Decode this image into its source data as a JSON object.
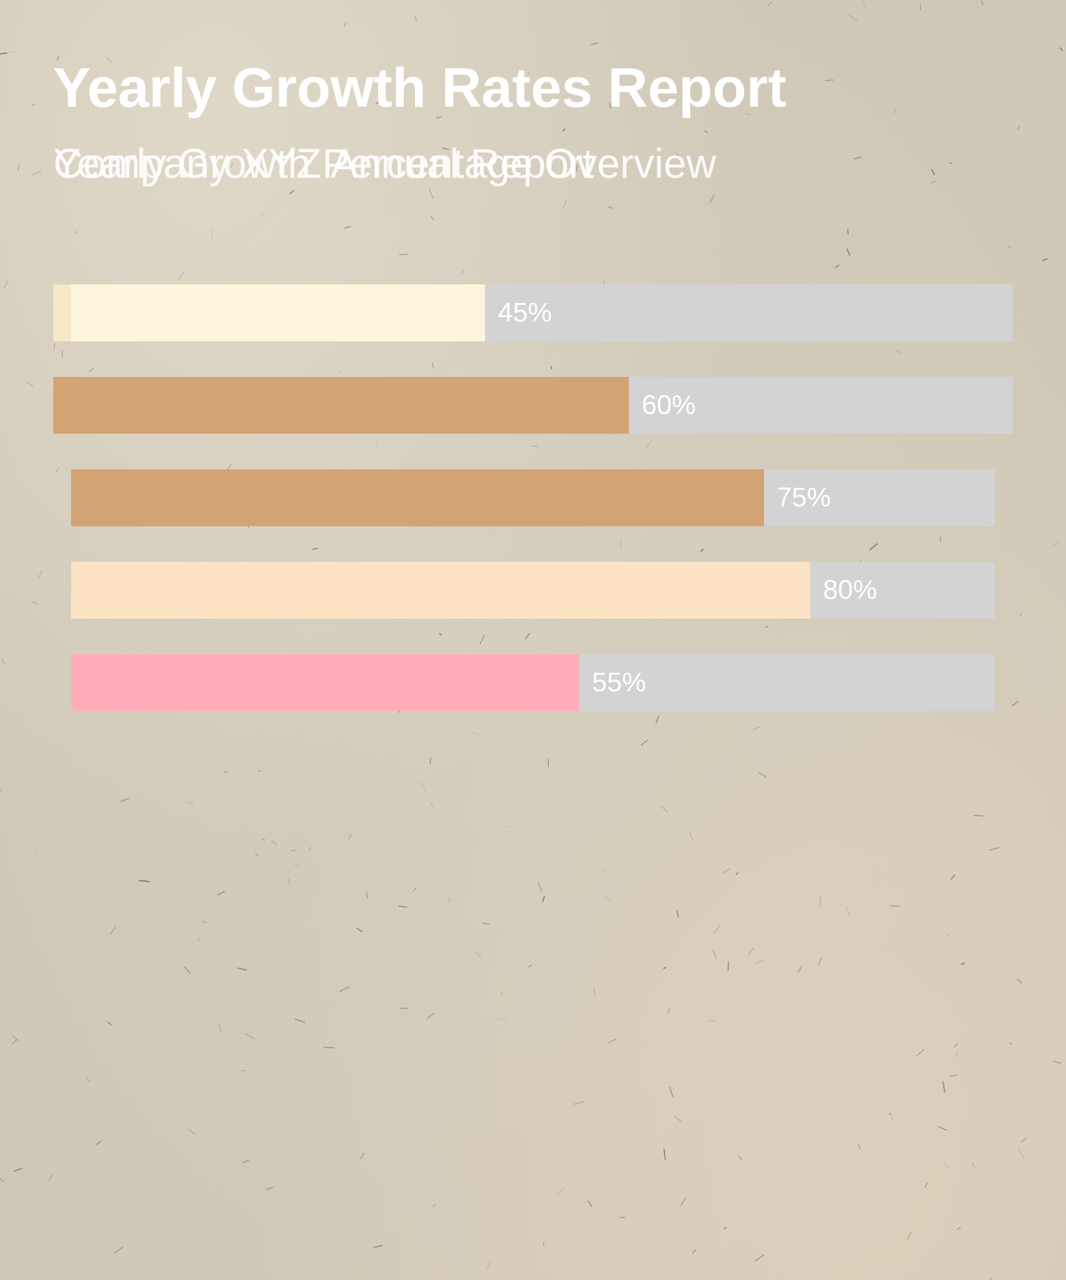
{
  "titles": {
    "main_a": "Yearly Growth Rates",
    "main_b": "Yearly Growth Rates Report",
    "sub_a": "Company XYZ Annual Report",
    "sub_b": "Yearly Growth Percentage Overview"
  },
  "colors": {
    "track": "#d3d3d3",
    "label": "#ffffff",
    "background": "#d6cfbf"
  },
  "chart_data": {
    "type": "bar",
    "orientation": "horizontal",
    "title": "Yearly Growth Rates",
    "subtitle": "Yearly Growth Percentage Overview",
    "xlim": [
      0,
      100
    ],
    "grid": false,
    "legend": "none",
    "values": [
      45,
      60,
      75,
      80,
      55
    ],
    "labels": [
      "45%",
      "60%",
      "75%",
      "80%",
      "55%"
    ],
    "colors": [
      "#fdf6dd",
      "#d4a373",
      "#d4a373",
      "#fbe3c3",
      "#ffadbb"
    ]
  }
}
